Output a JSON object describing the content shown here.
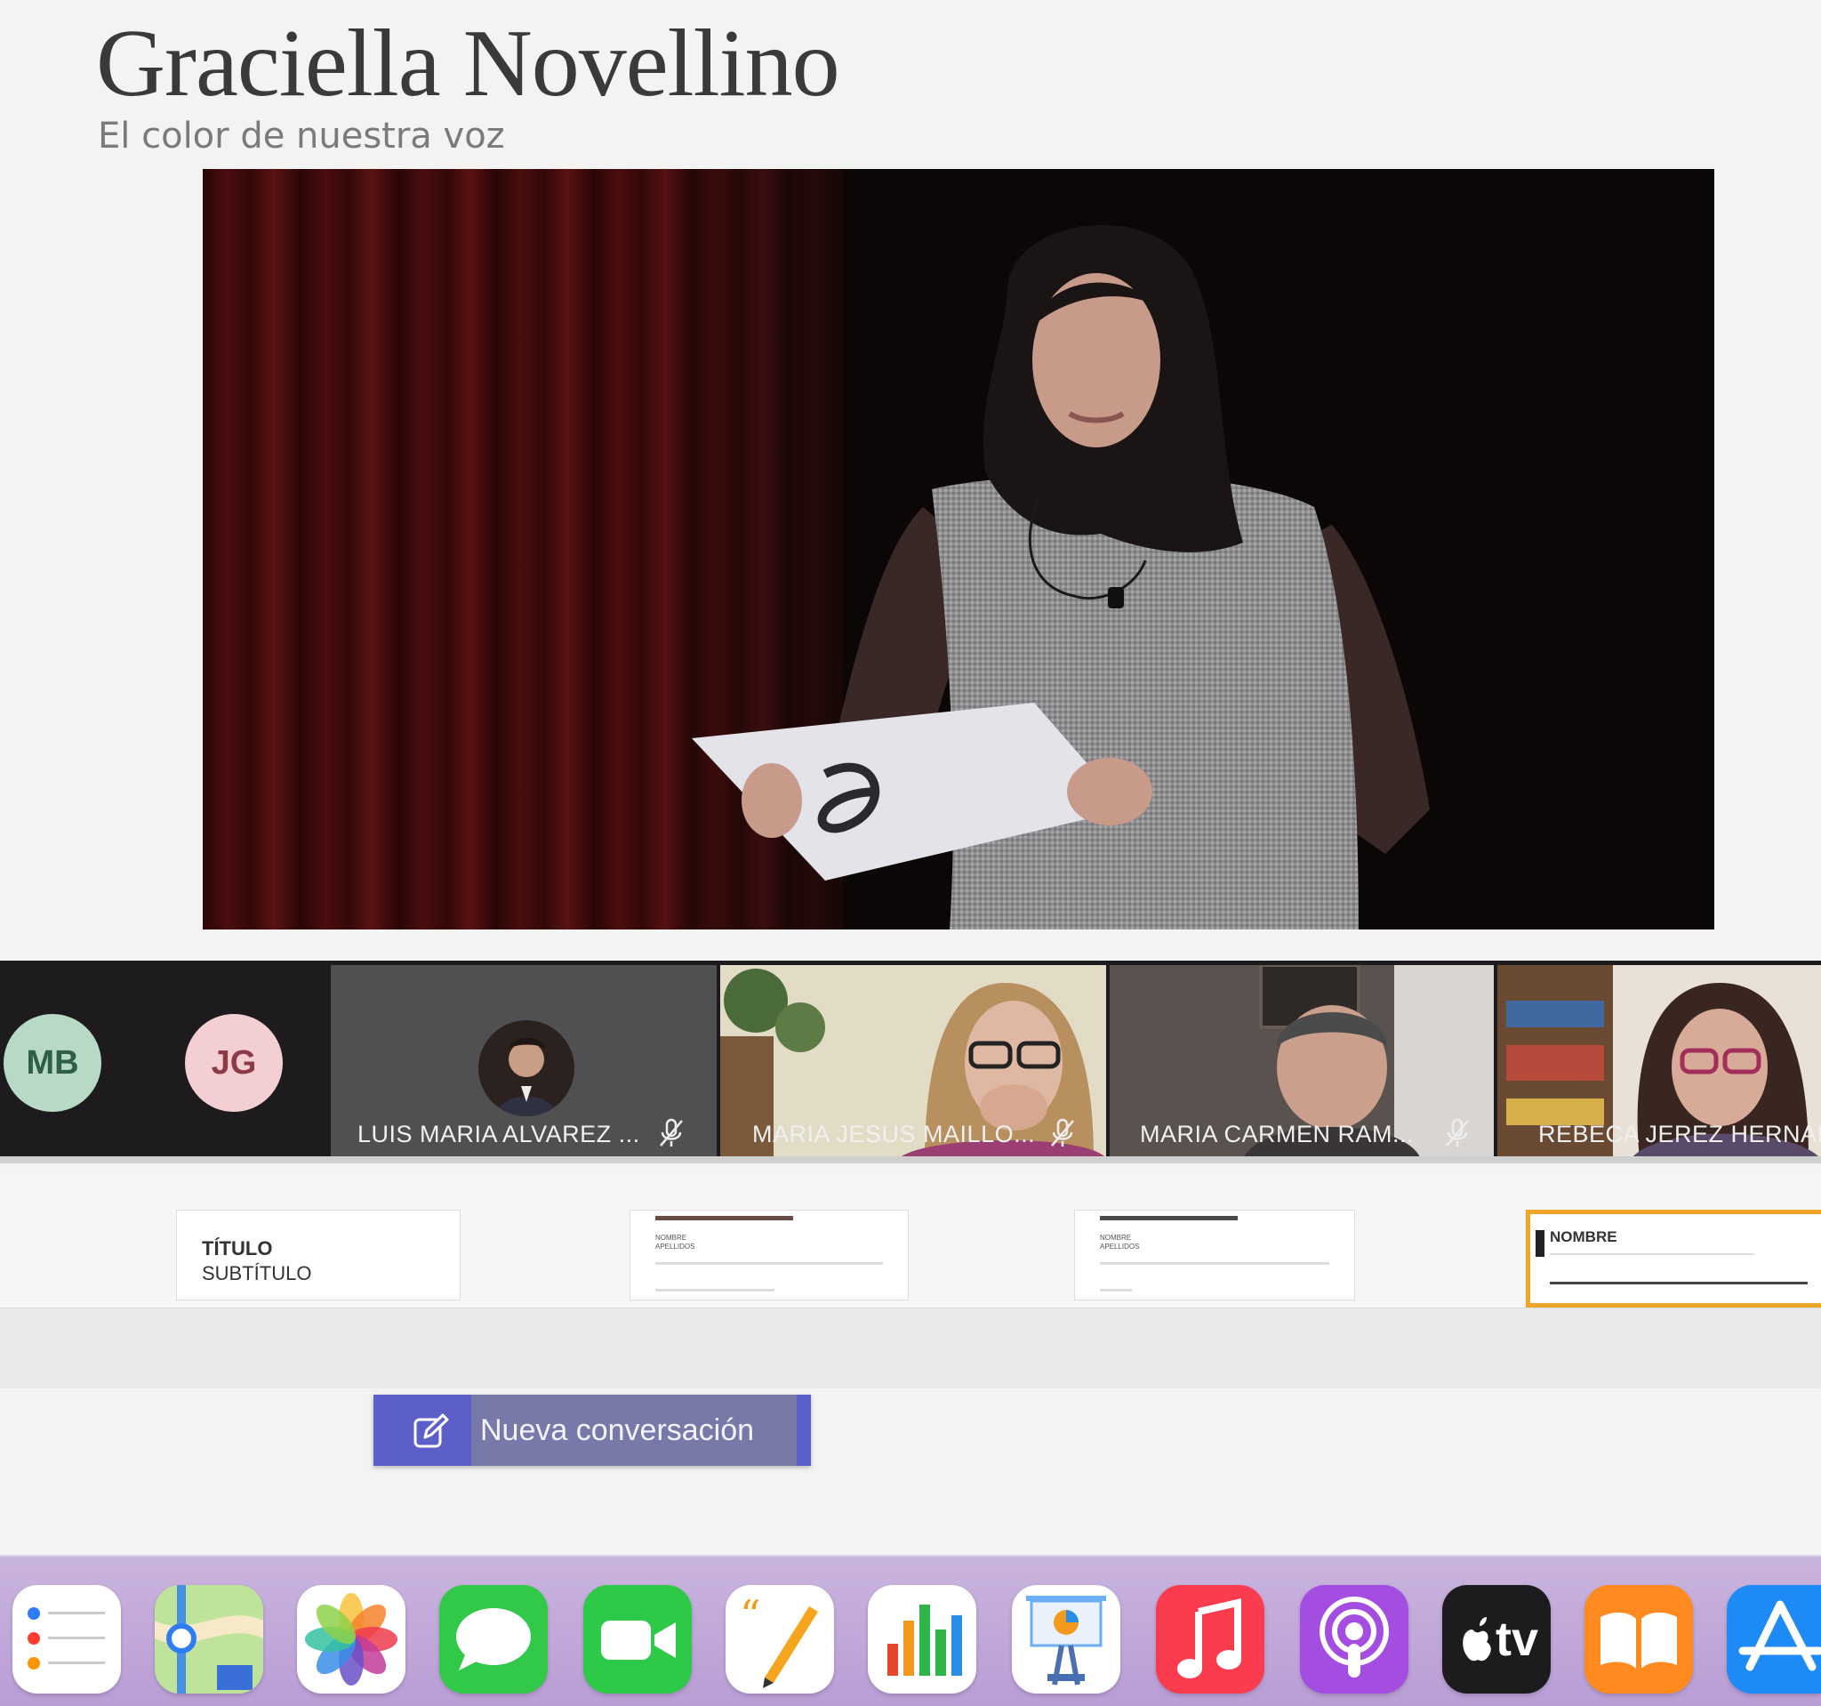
{
  "slide": {
    "title": "Graciella Novellino",
    "subtitle": "El color de nuestra voz"
  },
  "participants": {
    "initials": [
      {
        "text": "MB",
        "bg": "#b7d9c5",
        "fg": "#2f5f48"
      },
      {
        "text": "JG",
        "bg": "#f3cfd3",
        "fg": "#8c3a45"
      }
    ],
    "tiles": [
      {
        "name": "LUIS MARIA ALVAREZ ..."
      },
      {
        "name": "MARIA JESUS MAILLO..."
      },
      {
        "name": "MARIA CARMEN RAM..."
      },
      {
        "name": "REBECA JEREZ HERNAND"
      }
    ]
  },
  "templates": {
    "items": [
      {
        "line1": "TÍTULO",
        "line2": "SUBTÍTULO"
      },
      {
        "line1": "NOMBRE",
        "line2": "APELLIDOS"
      },
      {
        "line1": "NOMBRE",
        "line2": "APELLIDOS"
      },
      {
        "line1": "NOMBRE",
        "line2": ""
      }
    ]
  },
  "chat": {
    "new_conversation_label": "Nueva conversación"
  },
  "dock": {
    "apps": [
      {
        "name": "reminders-icon",
        "color": "#ffffff"
      },
      {
        "name": "maps-icon",
        "color": "#9fd47a"
      },
      {
        "name": "photos-icon",
        "color": "#ffffff"
      },
      {
        "name": "messages-icon",
        "color": "#32c848"
      },
      {
        "name": "facetime-icon",
        "color": "#2fc94a"
      },
      {
        "name": "pages-icon",
        "color": "#ffffff"
      },
      {
        "name": "numbers-icon",
        "color": "#ffffff"
      },
      {
        "name": "keynote-icon",
        "color": "#ffffff"
      },
      {
        "name": "music-icon",
        "color": "#fb3c4f"
      },
      {
        "name": "podcasts-icon",
        "color": "#a34ee0"
      },
      {
        "name": "tv-icon",
        "color": "#1c1c1e"
      },
      {
        "name": "books-icon",
        "color": "#ff8a1f"
      },
      {
        "name": "app-store-icon",
        "color": "#1e8af5"
      }
    ],
    "tv_label": "tv"
  }
}
